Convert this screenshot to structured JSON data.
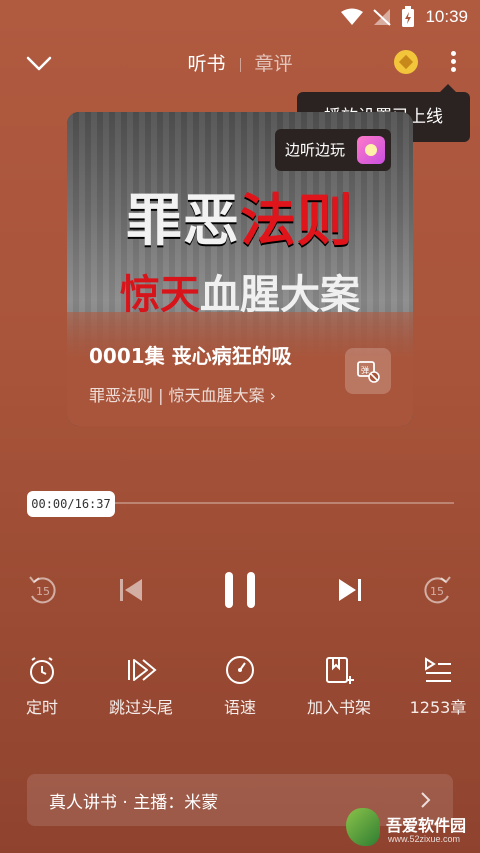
{
  "status_bar": {
    "time": "10:39"
  },
  "header": {
    "tabs": [
      {
        "label": "听书",
        "active": true
      },
      {
        "label": "章评",
        "active": false
      }
    ]
  },
  "tooltip": {
    "text": "播放设置已上线"
  },
  "badge": {
    "text": "边听边玩"
  },
  "cover": {
    "title_main": "罪恶",
    "title_accent": "法则",
    "subtitle_accent": "惊天",
    "subtitle_main": "血腥大案"
  },
  "episode": {
    "title": "0001集 丧心病狂的吸",
    "book_link": "罪恶法则 | 惊天血腥大案 ›"
  },
  "player": {
    "time_display": "00:00/16:37",
    "progress": 0.0,
    "rewind_seconds": "15",
    "forward_seconds": "15"
  },
  "actions": [
    {
      "label": "定时",
      "icon": "timer-icon"
    },
    {
      "label": "跳过头尾",
      "icon": "skip-intro-icon"
    },
    {
      "label": "语速",
      "icon": "speed-icon"
    },
    {
      "label": "加入书架",
      "icon": "bookshelf-add-icon"
    },
    {
      "label": "1253章",
      "icon": "chapter-list-icon"
    }
  ],
  "narrator": {
    "text": "真人讲书 · 主播：米蒙"
  },
  "watermark": {
    "text": "吾爱软件园",
    "sub": "www.52zixue.com"
  },
  "colors": {
    "background": "#a9553b",
    "tooltip_bg": "#2b2321",
    "accent_red": "#e0141b",
    "coin": "#f3c53b"
  }
}
